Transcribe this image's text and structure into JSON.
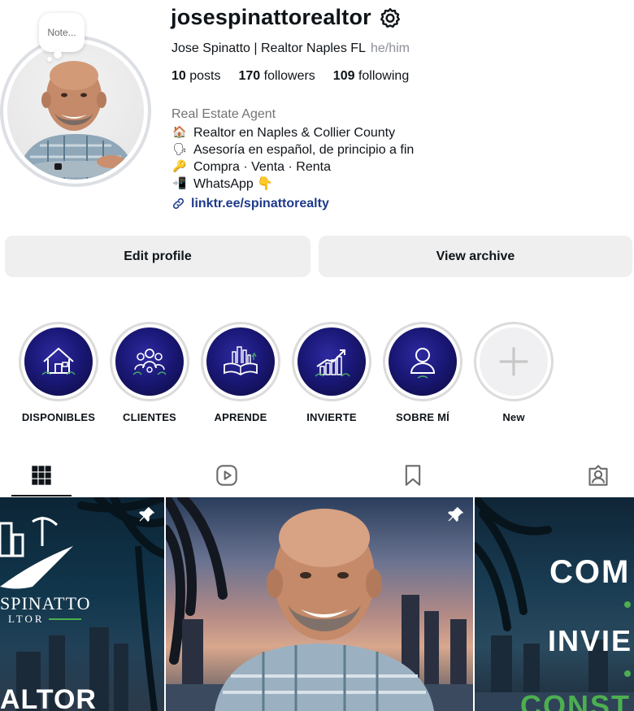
{
  "profile": {
    "username": "josespinattorealtor",
    "full_name": "Jose Spinatto | Realtor Naples FL",
    "pronouns": "he/him",
    "note_placeholder": "Note...",
    "stats": {
      "posts_count": "10",
      "posts_label": "posts",
      "followers_count": "170",
      "followers_label": "followers",
      "following_count": "109",
      "following_label": "following"
    },
    "category": "Real Estate Agent",
    "bio_lines": [
      {
        "emoji": "🏠",
        "text": "Realtor en Naples & Collier County"
      },
      {
        "emoji": "🗣",
        "text": "Asesoría en español, de principio a fin"
      },
      {
        "emoji": "🔑",
        "text": "Compra · Venta · Renta"
      },
      {
        "emoji": "📲",
        "text": "WhatsApp 👇"
      }
    ],
    "link": "linktr.ee/spinattorealty"
  },
  "actions": {
    "edit_profile": "Edit profile",
    "view_archive": "View archive"
  },
  "highlights": [
    {
      "label": "DISPONIBLES",
      "icon": "house-icon"
    },
    {
      "label": "CLIENTES",
      "icon": "people-icon"
    },
    {
      "label": "APRENDE",
      "icon": "book-city-icon"
    },
    {
      "label": "INVIERTE",
      "icon": "growth-chart-icon"
    },
    {
      "label": "SOBRE MÍ",
      "icon": "person-icon"
    },
    {
      "label": "New",
      "icon": "plus-icon"
    }
  ],
  "tabs": [
    {
      "name": "posts",
      "icon": "grid-icon",
      "active": true
    },
    {
      "name": "reels",
      "icon": "reels-icon",
      "active": false
    },
    {
      "name": "saved",
      "icon": "bookmark-icon",
      "active": false
    },
    {
      "name": "tagged",
      "icon": "tagged-icon",
      "active": false
    }
  ],
  "posts": [
    {
      "pinned": true,
      "text_1": "SPINATTO",
      "text_2": "LTOR",
      "text_3": "ALTOR"
    },
    {
      "pinned": true
    },
    {
      "pinned": false,
      "text_1": "COM",
      "text_2": "INVIE",
      "text_3": "CONST"
    }
  ]
}
